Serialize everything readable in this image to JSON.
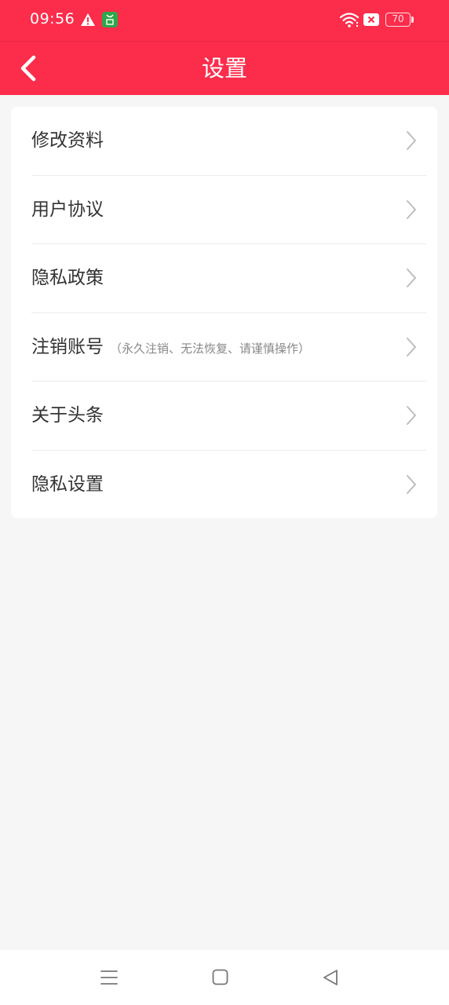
{
  "status_bar": {
    "time": "09:56",
    "battery": "70",
    "icons": [
      "warning-icon",
      "app-notification-icon",
      "wifi-icon",
      "no-sim-icon",
      "battery-icon"
    ]
  },
  "header": {
    "title": "设置",
    "back_icon": "chevron-left-icon"
  },
  "settings": {
    "items": [
      {
        "label": "修改资料",
        "note": ""
      },
      {
        "label": "用户协议",
        "note": ""
      },
      {
        "label": "隐私政策",
        "note": ""
      },
      {
        "label": "注销账号",
        "note": "（永久注销、无法恢复、请谨慎操作）"
      },
      {
        "label": "关于头条",
        "note": ""
      },
      {
        "label": "隐私设置",
        "note": ""
      }
    ]
  },
  "bottom_nav": {
    "icons": [
      "menu-icon",
      "home-icon",
      "back-triangle-icon"
    ]
  },
  "colors": {
    "accent": "#fc2c4b",
    "background": "#f6f6f6",
    "card": "#ffffff",
    "text": "#333333",
    "note": "#888888"
  }
}
